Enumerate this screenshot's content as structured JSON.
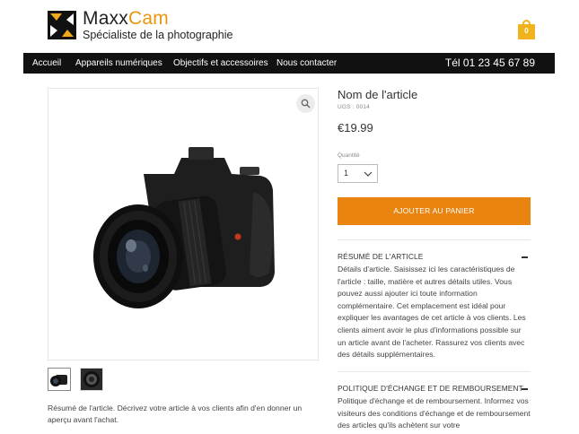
{
  "header": {
    "brand_main": "Maxx",
    "brand_accent": "Cam",
    "tagline": "Spécialiste de la photographie",
    "cart_count": "0",
    "accent_color": "#e8960c",
    "cart_icon": "shopping-bag-icon"
  },
  "nav": {
    "items": [
      "Accueil",
      "Appareils numériques",
      "Objectifs et accessoires",
      "Nous contacter"
    ],
    "phone": "Tél 01 23 45 67 89"
  },
  "product": {
    "name": "Nom de l'article",
    "sku": "UGS : 0014",
    "price": "€19.99",
    "quantity_label": "Quantité",
    "quantity_value": "1",
    "add_to_cart": "AJOUTER AU PANIER",
    "button_color": "#e98411",
    "summary": "Résumé de l'article. Décrivez votre article à vos clients afin d'en donner un aperçu avant l'achat.",
    "thumbnails_count": 2,
    "zoom_icon": "magnifier-icon"
  },
  "sections": [
    {
      "title": "RÉSUMÉ DE L'ARTICLE",
      "body": "Détails d'article. Saisissez ici les caractéristiques de l'article : taille, matière et autres détails utiles. Vous pouvez aussi ajouter ici toute information complémentaire. Cet emplacement est idéal pour expliquer les avantages de cet article à vos clients. Les clients aiment avoir le plus d'informations possible sur un article avant de l'acheter. Rassurez vos clients avec des détails supplémentaires."
    },
    {
      "title": "POLITIQUE D'ÉCHANGE ET DE REMBOURSEMENT",
      "body": "Politique d'échange et de remboursement. Informez vos visiteurs des conditions d'échange et de remboursement des articles qu'ils achètent sur votre"
    }
  ]
}
